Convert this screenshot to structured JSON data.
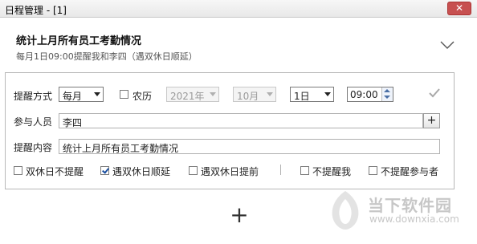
{
  "window": {
    "title": "日程管理 - [1]",
    "close_label": "✕"
  },
  "schedule": {
    "title": "统计上月所有员工考勤情况",
    "summary": "每月1日09:00提醒我和李四（遇双休日顺延）"
  },
  "reminder_mode": {
    "label": "提醒方式",
    "frequency": "每月",
    "lunar_label": "农历",
    "lunar_checked": false,
    "year": "2021年",
    "month": "10月",
    "day": "1日",
    "time": "09:00"
  },
  "participants": {
    "label": "参与人员",
    "value": "李四",
    "add_label": "+"
  },
  "content": {
    "label": "提醒内容",
    "value": "统计上月所有员工考勤情况"
  },
  "options": [
    {
      "label": "双休日不提醒",
      "checked": false
    },
    {
      "label": "遇双休日顺延",
      "checked": true
    },
    {
      "label": "遇双休日提前",
      "checked": false
    },
    {
      "label": "不提醒我",
      "checked": false
    },
    {
      "label": "不提醒参与者",
      "checked": false
    }
  ],
  "add_schedule_label": "+",
  "watermark": {
    "name": "当下软件园",
    "url": "www.downxia.com"
  },
  "colors": {
    "close_button": "#c75050",
    "check_mark": "#1a4fa0",
    "watermark": "#c7c7c7"
  },
  "icons": [
    "close-icon",
    "chevron-down-icon",
    "checkmark-icon",
    "plus-icon"
  ]
}
